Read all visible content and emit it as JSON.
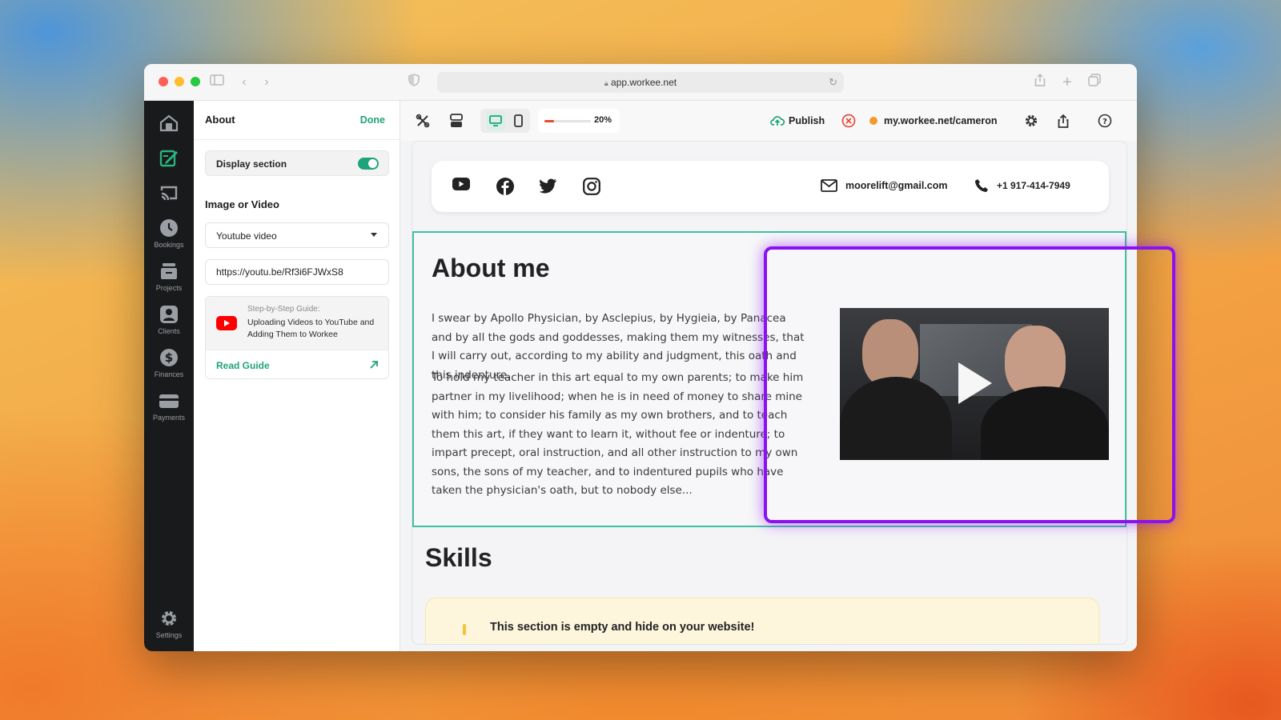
{
  "browser": {
    "url": "app.workee.net"
  },
  "rail": {
    "items": [
      {
        "label": "",
        "icon": "home-icon"
      },
      {
        "label": "",
        "icon": "edit-page-icon"
      },
      {
        "label": "",
        "icon": "cast-icon"
      },
      {
        "label": "Bookings",
        "icon": "clock-icon"
      },
      {
        "label": "Projects",
        "icon": "folder-icon"
      },
      {
        "label": "Clients",
        "icon": "person-icon"
      },
      {
        "label": "Finances",
        "icon": "dollar-icon"
      },
      {
        "label": "Payments",
        "icon": "card-icon"
      },
      {
        "label": "Settings",
        "icon": "gear-icon"
      }
    ]
  },
  "panel": {
    "title": "About",
    "done_label": "Done",
    "display_section_label": "Display section",
    "display_section_on": true,
    "media_heading": "Image or Video",
    "media_type": "Youtube video",
    "video_url": "https://youtu.be/Rf3i6FJWxS8",
    "guide": {
      "kicker": "Step-by-Step Guide:",
      "title": "Uploading Videos to YouTube and Adding Them to Workee",
      "link_label": "Read Guide"
    }
  },
  "toolbar": {
    "progress_percent": 20,
    "progress_label": "20%",
    "publish_label": "Publish",
    "site_url": "my.workee.net/cameron",
    "site_status_color": "#f29a2e"
  },
  "site": {
    "email": "moorelift@gmail.com",
    "phone": "+1 917-414-7949",
    "about_heading": "About me",
    "about_p1": "I swear by Apollo Physician, by Asclepius, by Hygieia, by Panacea and by all the gods and goddesses, making them my witnesses, that I will carry out, according to my ability and judgment, this oath and this indenture.",
    "about_p2": "To hold my teacher in this art equal to my own parents; to make him partner in my livelihood; when he is in need of money to share mine with him; to consider his family as my own brothers, and to teach them this art, if they want to learn it, without fee or indenture; to impart precept, oral instruction, and all other instruction to my own sons, the sons of my teacher, and to indentured pupils who have taken the physician's oath, but to nobody else...",
    "skills_heading": "Skills",
    "empty_notice": "This section is empty and hide on your website!"
  },
  "colors": {
    "accent": "#1fa37a",
    "section_border": "#3fc1a4",
    "highlight": "#8a12f0",
    "rail_bg": "#181a1c"
  }
}
